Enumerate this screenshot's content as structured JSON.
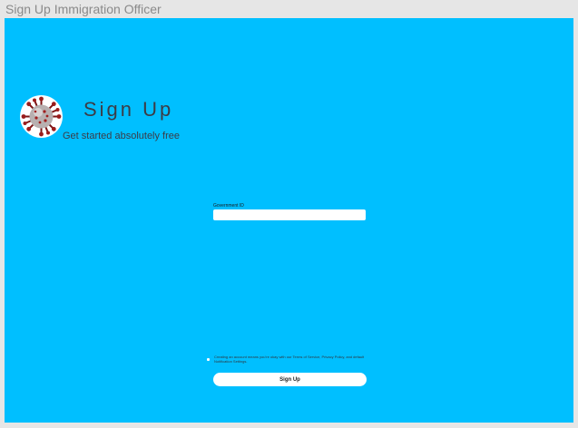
{
  "window": {
    "title": "Sign Up Immigration Officer"
  },
  "header": {
    "logo_icon": "virus-icon",
    "title": "Sign Up",
    "subtitle": "Get started absolutely free"
  },
  "form": {
    "government_id_label": "Government ID",
    "government_id_value": ""
  },
  "terms": {
    "text": "Creating an account means you're okay with our Terms of Service, Privacy Policy, and default Notification Settings."
  },
  "actions": {
    "signup_label": "Sign Up"
  },
  "colors": {
    "background": "#00bfff",
    "heading": "#3c3c46",
    "button": "#ffffff",
    "logo_virus": "#8b1a1a"
  }
}
